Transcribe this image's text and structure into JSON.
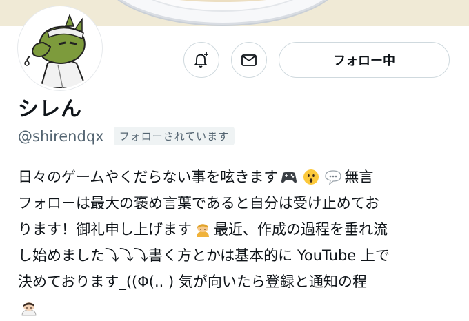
{
  "profile": {
    "name": "シレん",
    "handle": "@shirendqx",
    "follows_you_label": "フォローされています",
    "follow_button_label": "フォロー中",
    "bio": {
      "line1": "日々のゲームやくだらない事を呟きます",
      "line1_tail": "無言",
      "line2": "フォローは最大の褒め言葉であると自分は受け止めてお",
      "line3_a": "ります！御礼申し上げます",
      "line3_b": "最近、作成の過程を垂れ流",
      "line4": "し始めました⤵⤵⤵書く方とかは基本的に YouTube 上で",
      "line5": "決めております_((Φ(.. ) 気が向いたら登録と通知の程"
    }
  },
  "icons": {
    "bell": "bell-plus-icon",
    "mail": "envelope-icon",
    "emoji1": "game-controller-emoji",
    "emoji2": "surprised-face-emoji",
    "emoji3": "speech-bubble-emoji",
    "emoji4": "bowing-person-emoji",
    "emoji5": "bowing-person-emoji"
  },
  "colors": {
    "text": "#0f1419",
    "secondary": "#536471",
    "border": "#cfd9de"
  }
}
